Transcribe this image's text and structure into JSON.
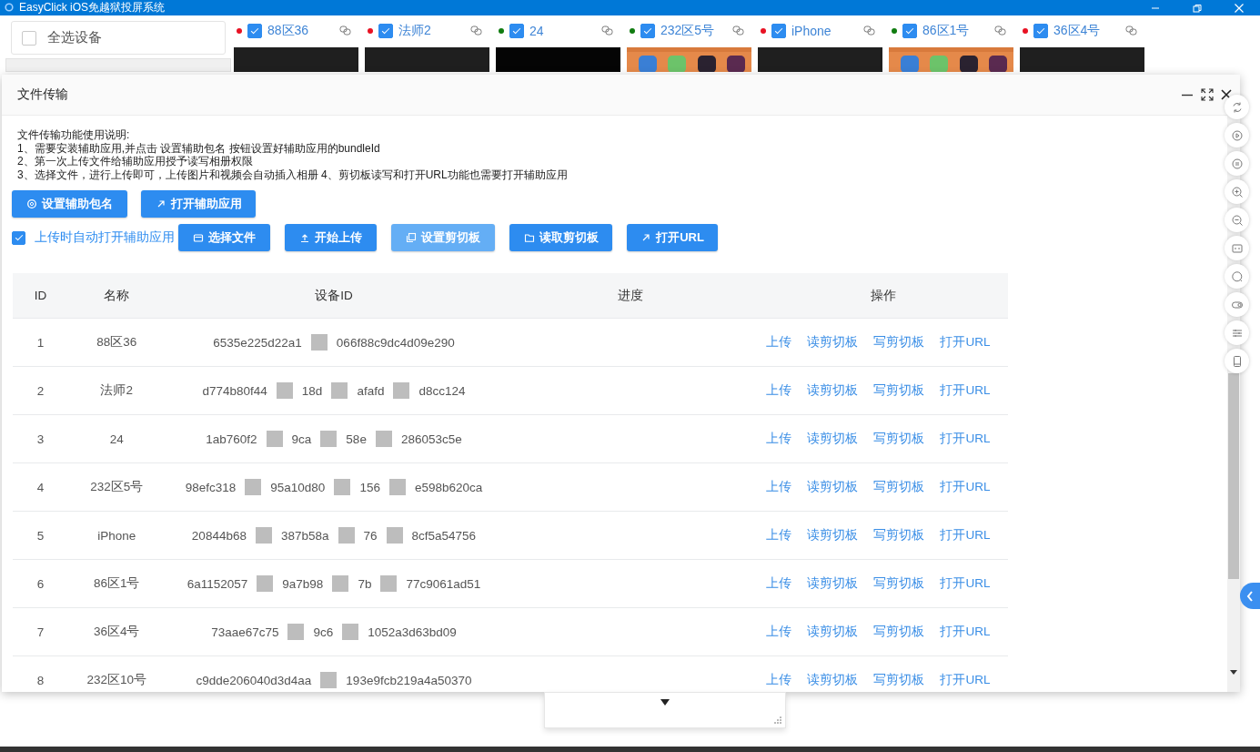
{
  "window": {
    "title": "EasyClick iOS免越狱投屏系统"
  },
  "select_all": {
    "label": "全选设备",
    "checked": false
  },
  "devices": [
    {
      "name": "88区36",
      "color": "#e81123",
      "checked": true,
      "kind": "blank"
    },
    {
      "name": "法师2",
      "color": "#e81123",
      "checked": true,
      "kind": "blank"
    },
    {
      "name": "24",
      "color": "#107c10",
      "checked": true,
      "kind": "blank"
    },
    {
      "name": "232区5号",
      "color": "#107c10",
      "checked": true,
      "kind": "picture"
    },
    {
      "name": "iPhone",
      "color": "#e81123",
      "checked": true,
      "kind": "blank"
    },
    {
      "name": "86区1号",
      "color": "#107c10",
      "checked": true,
      "kind": "picture"
    },
    {
      "name": "36区4号",
      "color": "#e81123",
      "checked": true,
      "kind": "blank"
    }
  ],
  "dialog": {
    "title": "文件传输",
    "instructions": [
      "文件传输功能使用说明:",
      "1、需要安装辅助应用,并点击 设置辅助包名 按钮设置好辅助应用的bundleId",
      "2、第一次上传文件给辅助应用授予读写相册权限",
      "3、选择文件，进行上传即可，上传图片和视频会自动插入相册  4、剪切板读写和打开URL功能也需要打开辅助应用"
    ],
    "setup_buttons": [
      {
        "label": "设置辅助包名"
      },
      {
        "label": "打开辅助应用"
      }
    ],
    "auto_open": {
      "label": "上传时自动打开辅助应用",
      "checked": true
    },
    "action_buttons": [
      {
        "label": "选择文件",
        "disabled": false
      },
      {
        "label": "开始上传",
        "disabled": false
      },
      {
        "label": "设置剪切板",
        "disabled": true
      },
      {
        "label": "读取剪切板",
        "disabled": false
      },
      {
        "label": "打开URL",
        "disabled": false
      }
    ],
    "table": {
      "columns": [
        "ID",
        "名称",
        "设备ID",
        "进度",
        "操作"
      ],
      "rows": [
        {
          "id": "1",
          "name": "88区36",
          "device_id": [
            "6535e225d22a1",
            "066f88c9dc4d09e290"
          ],
          "actions": [
            "上传",
            "读剪切板",
            "写剪切板",
            "打开URL"
          ]
        },
        {
          "id": "2",
          "name": "法师2",
          "device_id": [
            "d774b80f44",
            "18d",
            "afafd",
            "d8cc124"
          ],
          "actions": [
            "上传",
            "读剪切板",
            "写剪切板",
            "打开URL"
          ]
        },
        {
          "id": "3",
          "name": "24",
          "device_id": [
            "1ab760f2",
            "9ca",
            "58e",
            "286053c5e"
          ],
          "actions": [
            "上传",
            "读剪切板",
            "写剪切板",
            "打开URL"
          ]
        },
        {
          "id": "4",
          "name": "232区5号",
          "device_id": [
            "98efc318",
            "95a10d80",
            "156",
            "e598b620ca"
          ],
          "actions": [
            "上传",
            "读剪切板",
            "写剪切板",
            "打开URL"
          ]
        },
        {
          "id": "5",
          "name": "iPhone",
          "device_id": [
            "20844b68",
            "387b58a",
            "76",
            "8cf5a54756"
          ],
          "actions": [
            "上传",
            "读剪切板",
            "写剪切板",
            "打开URL"
          ]
        },
        {
          "id": "6",
          "name": "86区1号",
          "device_id": [
            "6a1152057",
            "9a7b98",
            "7b",
            "77c9061ad51"
          ],
          "actions": [
            "上传",
            "读剪切板",
            "写剪切板",
            "打开URL"
          ]
        },
        {
          "id": "7",
          "name": "36区4号",
          "device_id": [
            "73aae67c75",
            "9c6",
            "1052a3d63bd09"
          ],
          "actions": [
            "上传",
            "读剪切板",
            "写剪切板",
            "打开URL"
          ]
        },
        {
          "id": "8",
          "name": "232区10号",
          "device_id": [
            "c9dde206040d3d4aa",
            "193e9fcb219a4a50370"
          ],
          "actions": [
            "上传",
            "读剪切板",
            "写剪切板",
            "打开URL"
          ]
        }
      ]
    }
  }
}
